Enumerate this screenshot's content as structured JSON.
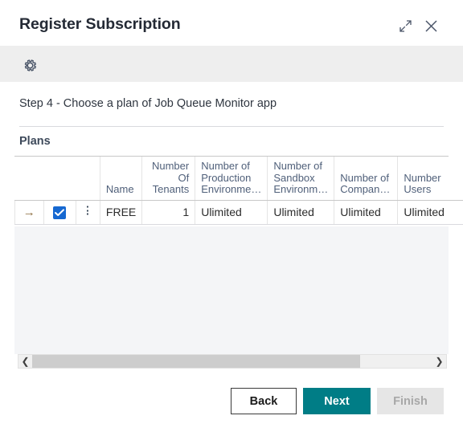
{
  "window": {
    "title": "Register Subscription",
    "expand_icon": "expand-diagonal-icon",
    "close_icon": "close-icon"
  },
  "toolbar": {
    "settings_icon": "gear-icon"
  },
  "body": {
    "step_text": "Step 4 - Choose a plan of Job Queue Monitor app",
    "plans_caption": "Plans"
  },
  "grid": {
    "headers": {
      "blank_a": "",
      "blank_b": "",
      "blank_c": "",
      "name": "Name",
      "number_of_tenants": "Number Of Tenants",
      "number_of_production_environments": "Number of Production Environme…",
      "number_of_sandbox_environments": "Number of Sandbox Environm…",
      "number_of_companies": "Number of Compan…",
      "number_users": "Number Users"
    },
    "rows": [
      {
        "indicator": "→",
        "selected": true,
        "menu_icon": "three-dots-vertical-icon",
        "name": "FREE",
        "number_of_tenants": "1",
        "number_of_production_environments": "Ulimited",
        "number_of_sandbox_environments": "Ulimited",
        "number_of_companies": "Ulimited",
        "number_users": "Ulimited"
      }
    ],
    "scrollbar": {
      "left_icon": "chevron-left-icon",
      "right_icon": "chevron-right-icon"
    }
  },
  "footer": {
    "back_label": "Back",
    "next_label": "Next",
    "finish_label": "Finish"
  },
  "colors": {
    "accent_teal": "#007d86",
    "checkbox_blue": "#1668d1",
    "row_menu_highlight": "#b0e2e9",
    "toolbar_gray": "#eeeeee",
    "empty_grid": "#f4f5f7",
    "header_text": "#50607a",
    "title_text": "#242a35"
  }
}
